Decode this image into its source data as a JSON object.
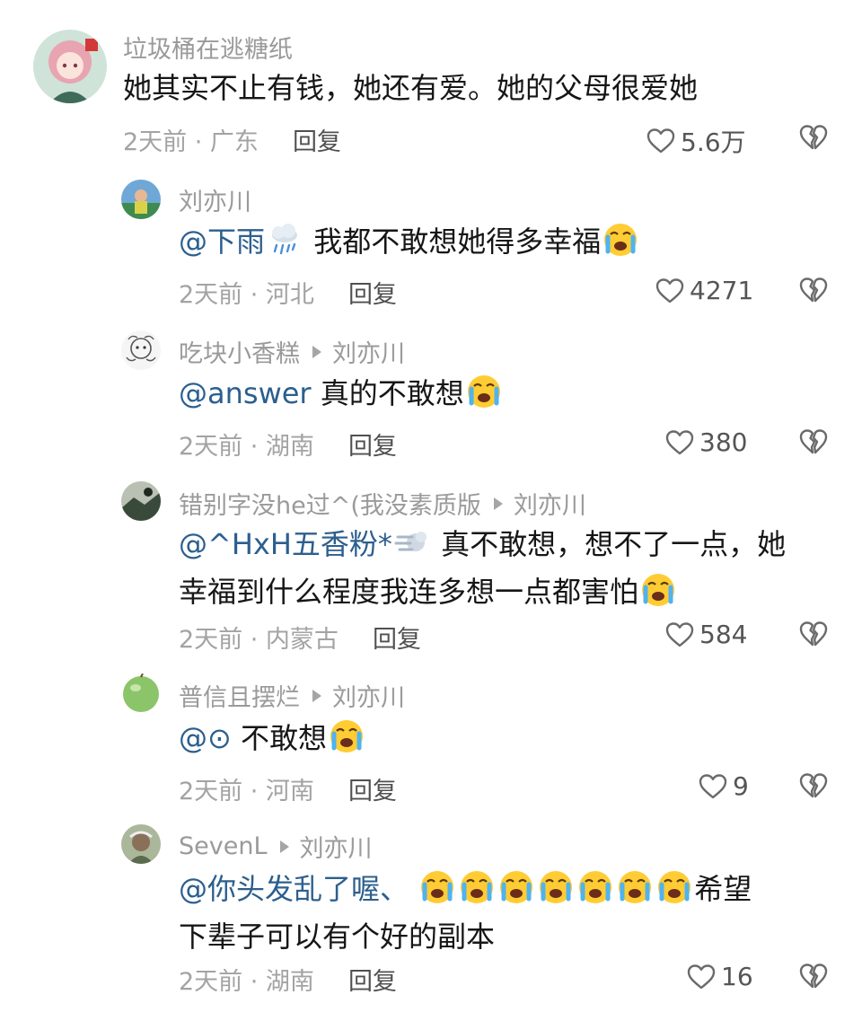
{
  "comments": [
    {
      "username": "垃圾桶在逃糖纸",
      "reply_to": "",
      "mention": "",
      "text_line1": "她其实不止有钱，她还有爱。她的父母很爱她",
      "text_line2": "",
      "time": "2天前 · 广东",
      "reply_label": "回复",
      "likes": "5.6万",
      "avatar_color": "#d99aa6"
    },
    {
      "username": "刘亦川",
      "reply_to": "",
      "mention": "@下雨",
      "text_line1": "我都不敢想她得多幸福",
      "text_line2": "",
      "time": "2天前 · 河北",
      "reply_label": "回复",
      "likes": "4271",
      "avatar_color": "#3f8a4f"
    },
    {
      "username": "吃块小香糕",
      "reply_to": "刘亦川",
      "mention": "@answer",
      "text_line1": "真的不敢想",
      "text_line2": "",
      "time": "2天前 · 湖南",
      "reply_label": "回复",
      "likes": "380",
      "avatar_color": "#eeeeee"
    },
    {
      "username": "错别字没he过^(我没素质版",
      "reply_to": "刘亦川",
      "mention": "@^HxH五香粉*",
      "text_line1": "真不敢想，想不了一点，她",
      "text_line2": "幸福到什么程度我连多想一点都害怕",
      "time": "2天前 · 内蒙古",
      "reply_label": "回复",
      "likes": "584",
      "avatar_color": "#4a5a48"
    },
    {
      "username": "普信且摆烂",
      "reply_to": "刘亦川",
      "mention": "@⊙",
      "text_line1": "不敢想",
      "text_line2": "",
      "time": "2天前 · 河南",
      "reply_label": "回复",
      "likes": "9",
      "avatar_color": "#8cc46a"
    },
    {
      "username": "SevenL",
      "reply_to": "刘亦川",
      "mention": "@你头发乱了喔、",
      "text_line1": "希望",
      "text_line2": "下辈子可以有个好的副本",
      "time": "2天前 · 湖南",
      "reply_label": "回复",
      "likes": "16",
      "avatar_color": "#7a8c6c"
    }
  ],
  "icons": {
    "like": "heart-outline-icon",
    "dislike": "broken-heart-icon",
    "emoji_cry": "loudly-crying-face-emoji",
    "emoji_rain": "cloud-with-rain-emoji",
    "emoji_dash": "dashing-away-emoji"
  },
  "colors": {
    "mention": "#2c5f8e",
    "meta": "#a3a3a3"
  }
}
